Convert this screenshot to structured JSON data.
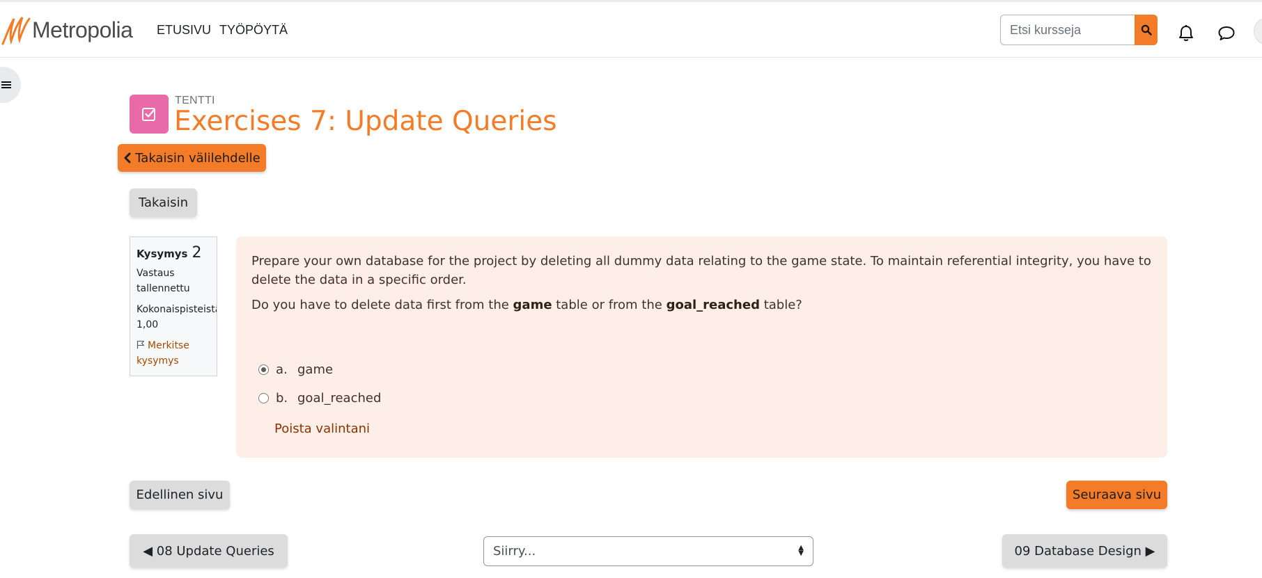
{
  "header": {
    "logo_text": "Metropolia",
    "nav": [
      {
        "label": "ETUSIVU"
      },
      {
        "label": "TYÖPÖYTÄ"
      }
    ],
    "search": {
      "placeholder": "Etsi kursseja",
      "value": ""
    },
    "icons": [
      "search-icon",
      "bell-icon",
      "chat-bubble-icon",
      "user-menu"
    ],
    "accent_color": "#f47c28"
  },
  "activity": {
    "type": "TENTTI",
    "title": "Exercises 7: Update Queries",
    "icon": "quiz-checkbox-icon",
    "icon_color": "#e96aa8"
  },
  "buttons": {
    "back_to_tab": "Takaisin välilehdelle",
    "back": "Takaisin",
    "previous_page": "Edellinen sivu",
    "next_page": "Seuraava sivu"
  },
  "question_info": {
    "label": "Kysymys",
    "number": "2",
    "status_line1": "Vastaus",
    "status_line2": "tallennettu",
    "points_label": "Kokonaispisteistä",
    "points_value": "1,00",
    "flag_line1": "Merkitse",
    "flag_line2": "kysymys"
  },
  "question": {
    "p1": "Prepare your own database for the project by deleting all dummy data relating to the game state. To maintain referential integrity, you have to delete the data in a specific order.",
    "p2_pre": "Do you have to delete data first from the ",
    "p2_b1": "game",
    "p2_mid": " table or from the ",
    "p2_b2": "goal_reached",
    "p2_post": " table?",
    "answers": [
      {
        "letter": "a.",
        "text": "game",
        "selected": true
      },
      {
        "letter": "b.",
        "text": "goal_reached",
        "selected": false
      }
    ],
    "clear_choice": "Poista valintani"
  },
  "activity_nav": {
    "prev": "◀ 08 Update Queries",
    "jump_placeholder": "Siirry...",
    "next": "09 Database Design ▶"
  }
}
